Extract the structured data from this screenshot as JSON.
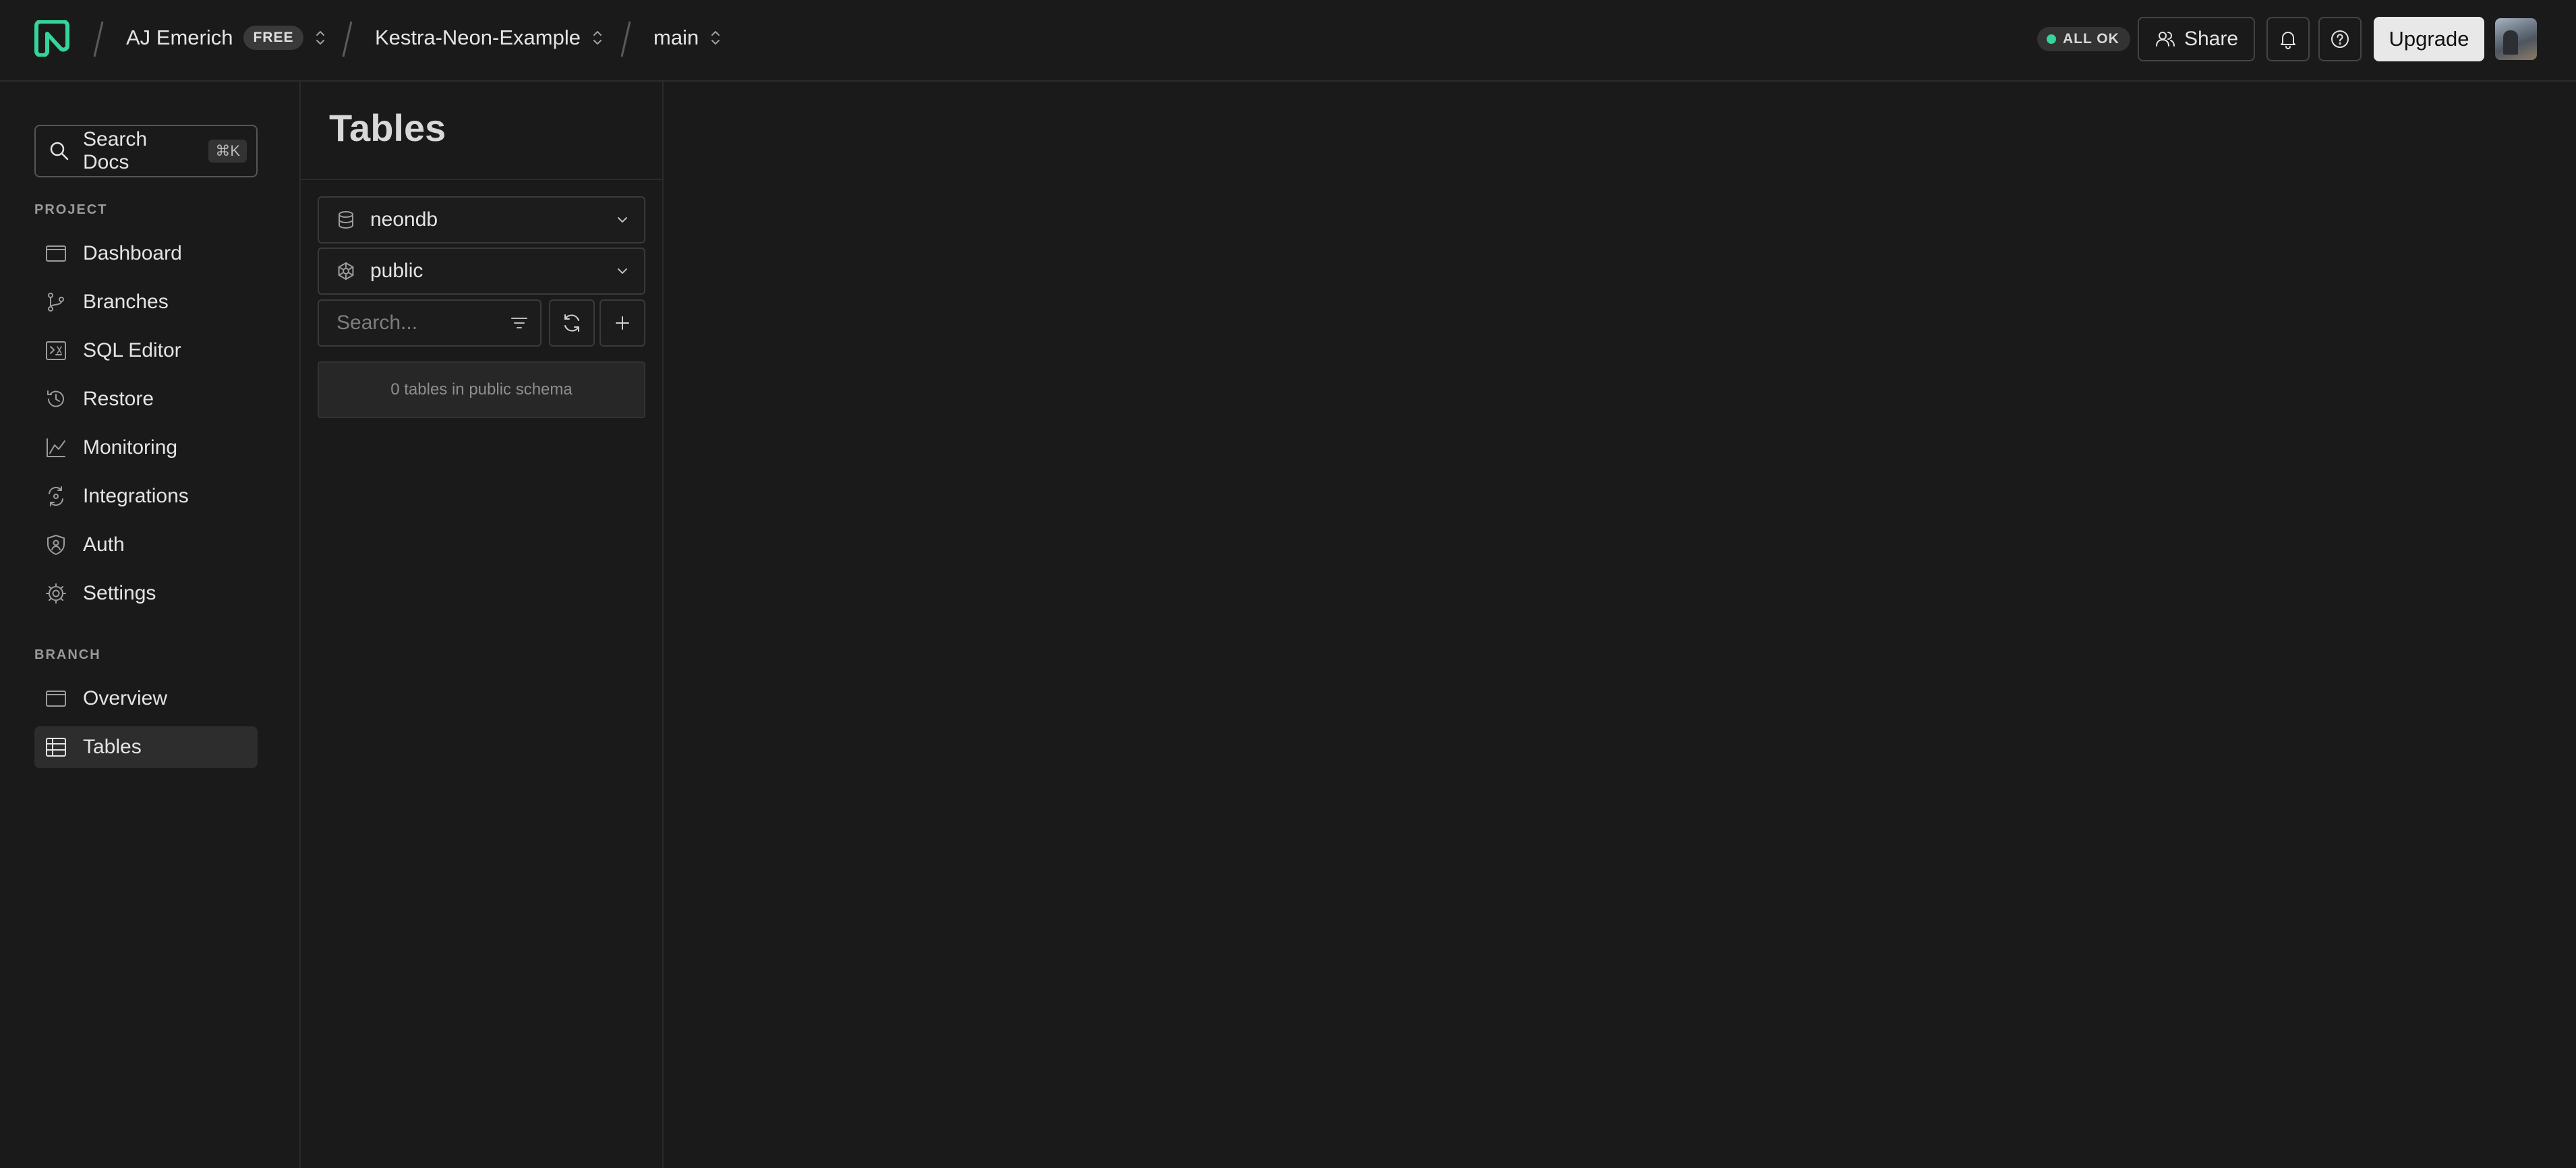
{
  "header": {
    "breadcrumbs": [
      {
        "label": "AJ Emerich",
        "badge": "FREE"
      },
      {
        "label": "Kestra-Neon-Example"
      },
      {
        "label": "main"
      }
    ],
    "status": "ALL OK",
    "status_color": "#34d59a",
    "share_label": "Share",
    "upgrade_label": "Upgrade"
  },
  "sidebar": {
    "search": {
      "label": "Search Docs",
      "shortcut": "⌘K"
    },
    "project_label": "PROJECT",
    "project_items": [
      {
        "label": "Dashboard",
        "icon": "dashboard-icon"
      },
      {
        "label": "Branches",
        "icon": "branch-icon"
      },
      {
        "label": "SQL Editor",
        "icon": "sql-editor-icon"
      },
      {
        "label": "Restore",
        "icon": "restore-icon"
      },
      {
        "label": "Monitoring",
        "icon": "monitoring-icon"
      },
      {
        "label": "Integrations",
        "icon": "integrations-icon"
      },
      {
        "label": "Auth",
        "icon": "auth-icon"
      },
      {
        "label": "Settings",
        "icon": "gear-icon"
      }
    ],
    "branch_label": "BRANCH",
    "branch_items": [
      {
        "label": "Overview",
        "icon": "overview-icon"
      },
      {
        "label": "Tables",
        "icon": "table-icon",
        "active": true
      }
    ]
  },
  "panel": {
    "title": "Tables",
    "database": "neondb",
    "schema": "public",
    "search_placeholder": "Search...",
    "empty_message": "0 tables in public schema"
  },
  "colors": {
    "accent": "#34d59a",
    "background": "#1a1a1a"
  }
}
